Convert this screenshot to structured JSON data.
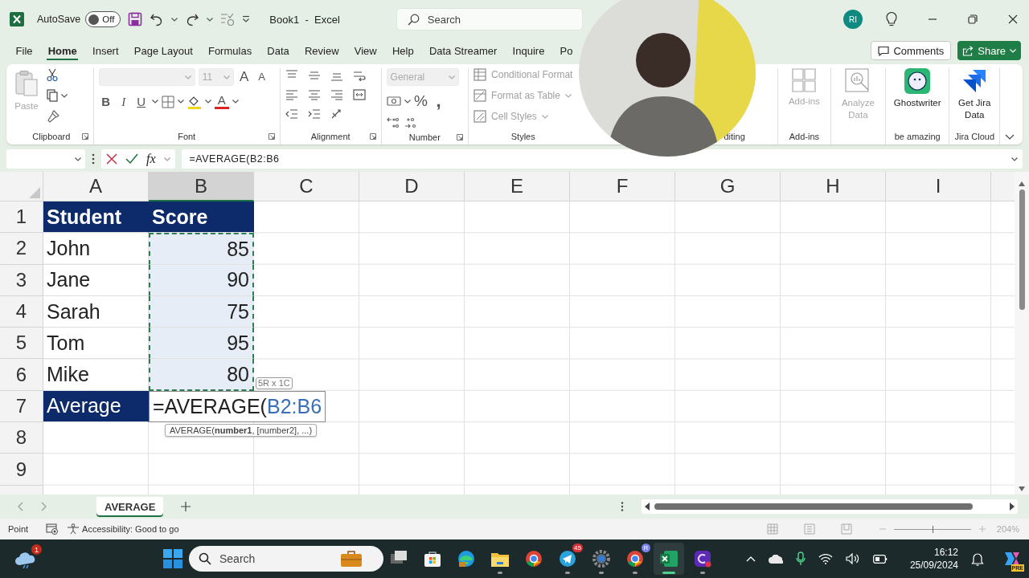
{
  "title_bar": {
    "autosave_label": "AutoSave",
    "autosave": {
      "on": false,
      "label": "Off"
    },
    "document_title": "Book1  -  Excel",
    "search": {
      "placeholder": "Search"
    },
    "account_initials": "RI"
  },
  "ribbon_tabs": [
    {
      "label": "File",
      "selected": false
    },
    {
      "label": "Home",
      "selected": true
    },
    {
      "label": "Insert",
      "selected": false
    },
    {
      "label": "Page Layout",
      "selected": false
    },
    {
      "label": "Formulas",
      "selected": false
    },
    {
      "label": "Data",
      "selected": false
    },
    {
      "label": "Review",
      "selected": false
    },
    {
      "label": "View",
      "selected": false
    },
    {
      "label": "Help",
      "selected": false
    },
    {
      "label": "Data Streamer",
      "selected": false
    },
    {
      "label": "Inquire",
      "selected": false
    },
    {
      "label": "Po",
      "selected": false
    }
  ],
  "ribbon_actions": {
    "comments": "Comments",
    "share": "Share"
  },
  "ribbon_groups": [
    {
      "kind": "clipboard",
      "label": "Clipboard",
      "paste": {
        "label": "Paste",
        "disabled": true
      }
    },
    {
      "kind": "font",
      "label": "Font",
      "font_size": "11",
      "disabled": true,
      "grow": "A",
      "shrink": "A",
      "style_buttons": [
        "B",
        "I",
        "U"
      ],
      "color_glyph": "A"
    },
    {
      "kind": "alignment",
      "label": "Alignment"
    },
    {
      "kind": "number",
      "label": "Number",
      "number_format": "General",
      "disabled": true,
      "percent": "%",
      "comma": ","
    },
    {
      "kind": "styles",
      "label": "Styles",
      "items": [
        {
          "label": "Conditional Format",
          "disabled": true
        },
        {
          "label": "Format as Table",
          "disabled": true
        },
        {
          "label": "Cell Styles",
          "disabled": true
        }
      ]
    },
    {
      "kind": "editing",
      "label": "diting"
    },
    {
      "kind": "addins",
      "label": "Add-ins",
      "button": {
        "label": "Add-ins",
        "disabled": true
      }
    },
    {
      "kind": "analyze",
      "button": {
        "label": "Analyze Data",
        "disabled": true
      }
    },
    {
      "kind": "ghostwriter",
      "label": "be amazing",
      "button": {
        "label": "Ghostwriter",
        "disabled": false
      }
    },
    {
      "kind": "jira",
      "label": "Jira Cloud",
      "button": {
        "label": "Get Jira Data",
        "disabled": false
      }
    }
  ],
  "formula_bar": {
    "function_button": "fx",
    "formula": "=AVERAGE(B2:B6"
  },
  "sheet": {
    "columns": [
      {
        "label": "A",
        "selected": false
      },
      {
        "label": "B",
        "selected": true
      },
      {
        "label": "C",
        "selected": false
      },
      {
        "label": "D",
        "selected": false
      },
      {
        "label": "E",
        "selected": false
      },
      {
        "label": "F",
        "selected": false
      },
      {
        "label": "G",
        "selected": false
      },
      {
        "label": "H",
        "selected": false
      },
      {
        "label": "I",
        "selected": false
      }
    ],
    "rows": [
      {
        "label": "1",
        "cells": [
          {
            "kind": "header",
            "text": "Student"
          },
          {
            "kind": "header",
            "text": "Score"
          }
        ]
      },
      {
        "label": "2",
        "cells": [
          {
            "kind": "text",
            "text": "John"
          },
          {
            "kind": "number",
            "text": "85",
            "in_range": true
          }
        ]
      },
      {
        "label": "3",
        "cells": [
          {
            "kind": "text",
            "text": "Jane"
          },
          {
            "kind": "number",
            "text": "90",
            "in_range": true
          }
        ]
      },
      {
        "label": "4",
        "cells": [
          {
            "kind": "text",
            "text": "Sarah"
          },
          {
            "kind": "number",
            "text": "75",
            "in_range": true
          }
        ]
      },
      {
        "label": "5",
        "cells": [
          {
            "kind": "text",
            "text": "Tom"
          },
          {
            "kind": "number",
            "text": "95",
            "in_range": true
          }
        ]
      },
      {
        "label": "6",
        "cells": [
          {
            "kind": "text",
            "text": "Mike"
          },
          {
            "kind": "number",
            "text": "80",
            "in_range": true
          }
        ]
      },
      {
        "label": "7",
        "cells": [
          {
            "kind": "total",
            "text": "Average"
          },
          {
            "kind": "formula",
            "text": "=AVERAGE(",
            "reference": "B2:B6",
            "editing": true
          }
        ]
      },
      {
        "label": "8"
      },
      {
        "label": "9"
      }
    ],
    "range_tooltip": "5R x 1C",
    "function_hint": "AVERAGE(**number1**, [number2], ...)"
  },
  "sheet_tabs": [
    {
      "label": "AVERAGE",
      "selected": true
    }
  ],
  "status_bar": {
    "mode": "Point",
    "accessibility": "Accessibility: Good to go",
    "zoom": {
      "level": 0.5,
      "label": "204%"
    }
  },
  "taskbar": {
    "weather_badge": "1",
    "search": {
      "placeholder": "Search"
    },
    "apps": [
      {
        "kind": "taskview",
        "running": false,
        "active": false
      },
      {
        "kind": "store",
        "running": false,
        "active": false
      },
      {
        "kind": "edge",
        "running": false,
        "active": false
      },
      {
        "kind": "explorer",
        "running": true,
        "active": false
      },
      {
        "kind": "chrome",
        "running": false,
        "active": false
      },
      {
        "kind": "telegram",
        "running": true,
        "active": false,
        "badge": "45"
      },
      {
        "kind": "settings",
        "running": true,
        "active": false
      },
      {
        "kind": "chromeprofile",
        "running": true,
        "active": false,
        "badge": "R"
      },
      {
        "kind": "excel",
        "running": true,
        "active": true
      },
      {
        "kind": "app",
        "running": true,
        "active": false
      }
    ],
    "time": "16:12",
    "date": "25/09/2024",
    "copilot_tag": "PRE"
  }
}
